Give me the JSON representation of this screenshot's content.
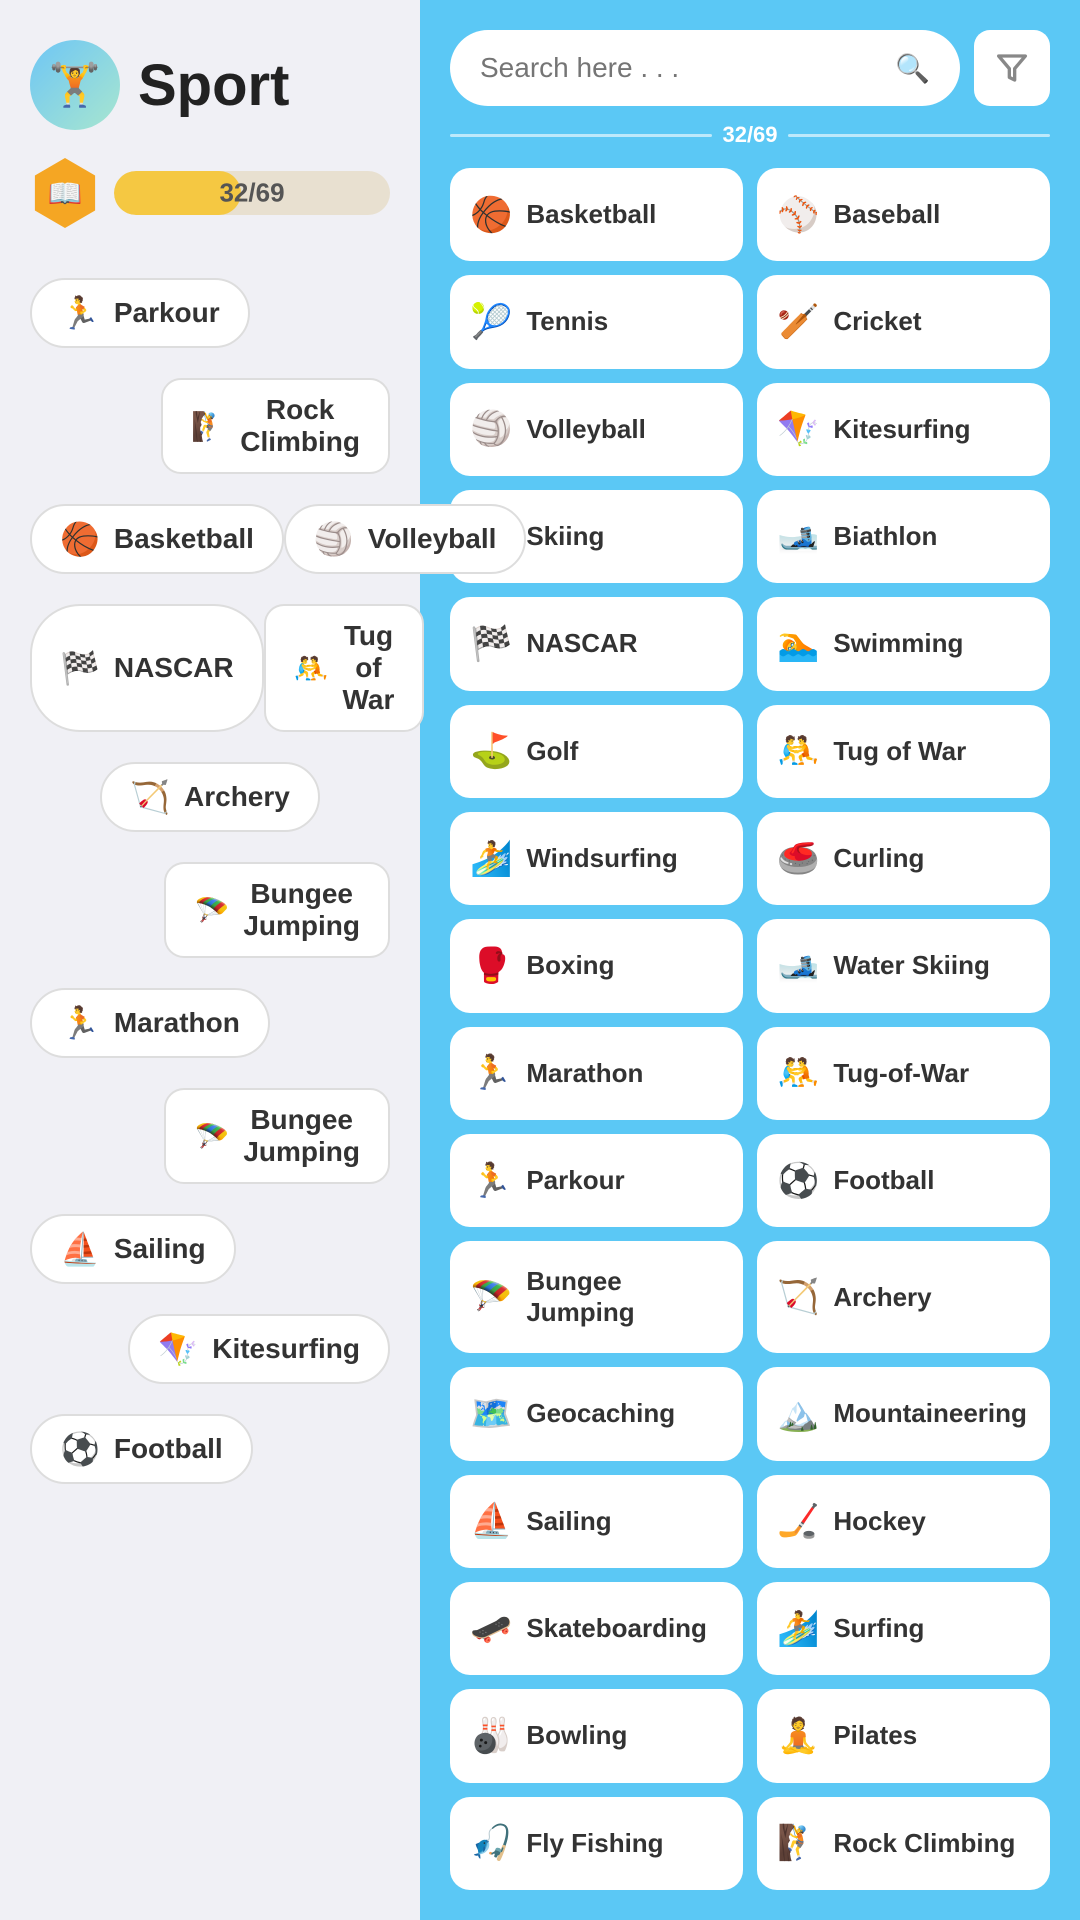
{
  "app": {
    "title": "Sport",
    "logo_emoji": "🏋️",
    "progress": {
      "current": 32,
      "total": 69,
      "display": "32/69",
      "percent": 46,
      "icon_emoji": "📖"
    }
  },
  "left_panel": {
    "items": [
      {
        "id": "parkour",
        "label": "Parkour",
        "emoji": "🏃",
        "row": 1,
        "indent": "left"
      },
      {
        "id": "rock-climbing",
        "label": "Rock\nClimbing",
        "emoji": "🧗",
        "row": 2,
        "indent": "right",
        "multiline": true
      },
      {
        "id": "basketball",
        "label": "Basketball",
        "emoji": "🏀",
        "row": 3,
        "indent": "left"
      },
      {
        "id": "volleyball",
        "label": "Volleyball",
        "emoji": "🏐",
        "row": 3,
        "indent": "right"
      },
      {
        "id": "nascar",
        "label": "NASCAR",
        "emoji": "🏁",
        "row": 4,
        "indent": "left"
      },
      {
        "id": "tug-of-war",
        "label": "Tug of\nWar",
        "emoji": "🤼",
        "row": 4,
        "indent": "right",
        "multiline": true
      },
      {
        "id": "archery",
        "label": "Archery",
        "emoji": "🏹",
        "row": 5,
        "indent": "mid"
      },
      {
        "id": "bungee-jumping-1",
        "label": "Bungee\nJumping",
        "emoji": "🪂",
        "row": 6,
        "indent": "right",
        "multiline": true
      },
      {
        "id": "marathon",
        "label": "Marathon",
        "emoji": "🏃",
        "row": 7,
        "indent": "left"
      },
      {
        "id": "bungee-jumping-2",
        "label": "Bungee\nJumping",
        "emoji": "🪂",
        "row": 8,
        "indent": "right",
        "multiline": true
      },
      {
        "id": "sailing",
        "label": "Sailing",
        "emoji": "⛵",
        "row": 9,
        "indent": "left"
      },
      {
        "id": "kitesurfing",
        "label": "Kitesurfing",
        "emoji": "🪁",
        "row": 10,
        "indent": "right"
      },
      {
        "id": "football",
        "label": "Football",
        "emoji": "⚽",
        "row": 11,
        "indent": "left"
      }
    ]
  },
  "right_panel": {
    "search_placeholder": "Search here . . .",
    "progress_display": "32/69",
    "items": [
      {
        "id": "basketball",
        "label": "Basketball",
        "emoji": "🏀"
      },
      {
        "id": "baseball",
        "label": "Baseball",
        "emoji": "⚾"
      },
      {
        "id": "tennis",
        "label": "Tennis",
        "emoji": "🎾"
      },
      {
        "id": "cricket",
        "label": "Cricket",
        "emoji": "🏏"
      },
      {
        "id": "volleyball",
        "label": "Volleyball",
        "emoji": "🏐"
      },
      {
        "id": "kitesurfing",
        "label": "Kitesurfing",
        "emoji": "🪁"
      },
      {
        "id": "skiing",
        "label": "Skiing",
        "emoji": "⛷️"
      },
      {
        "id": "biathlon",
        "label": "Biathlon",
        "emoji": "🎿"
      },
      {
        "id": "nascar",
        "label": "NASCAR",
        "emoji": "🏁"
      },
      {
        "id": "swimming",
        "label": "Swimming",
        "emoji": "🏊"
      },
      {
        "id": "golf",
        "label": "Golf",
        "emoji": "⛳"
      },
      {
        "id": "tug-of-war",
        "label": "Tug of War",
        "emoji": "🤼"
      },
      {
        "id": "windsurfing",
        "label": "Windsurfing",
        "emoji": "🏄"
      },
      {
        "id": "curling",
        "label": "Curling",
        "emoji": "🥌"
      },
      {
        "id": "boxing",
        "label": "Boxing",
        "emoji": "🥊"
      },
      {
        "id": "water-skiing",
        "label": "Water Skiing",
        "emoji": "🎿"
      },
      {
        "id": "marathon",
        "label": "Marathon",
        "emoji": "🏃"
      },
      {
        "id": "tug-of-war-2",
        "label": "Tug-of-War",
        "emoji": "🤼"
      },
      {
        "id": "parkour",
        "label": "Parkour",
        "emoji": "🏃"
      },
      {
        "id": "football",
        "label": "Football",
        "emoji": "⚽"
      },
      {
        "id": "bungee-jumping",
        "label": "Bungee Jumping",
        "emoji": "🪂"
      },
      {
        "id": "archery",
        "label": "Archery",
        "emoji": "🏹"
      },
      {
        "id": "geocaching",
        "label": "Geocaching",
        "emoji": "🗺️"
      },
      {
        "id": "mountaineering",
        "label": "Mountaineering",
        "emoji": "🏔️"
      },
      {
        "id": "sailing",
        "label": "Sailing",
        "emoji": "⛵"
      },
      {
        "id": "hockey",
        "label": "Hockey",
        "emoji": "🏒"
      },
      {
        "id": "skateboarding",
        "label": "Skateboarding",
        "emoji": "🛹"
      },
      {
        "id": "surfing",
        "label": "Surfing",
        "emoji": "🏄"
      },
      {
        "id": "bowling",
        "label": "Bowling",
        "emoji": "🎳"
      },
      {
        "id": "pilates",
        "label": "Pilates",
        "emoji": "🧘"
      },
      {
        "id": "fly-fishing",
        "label": "Fly Fishing",
        "emoji": "🎣"
      },
      {
        "id": "rock-climbing",
        "label": "Rock Climbing",
        "emoji": "🧗"
      }
    ]
  },
  "icons": {
    "search": "🔍",
    "filter": "⚗"
  }
}
